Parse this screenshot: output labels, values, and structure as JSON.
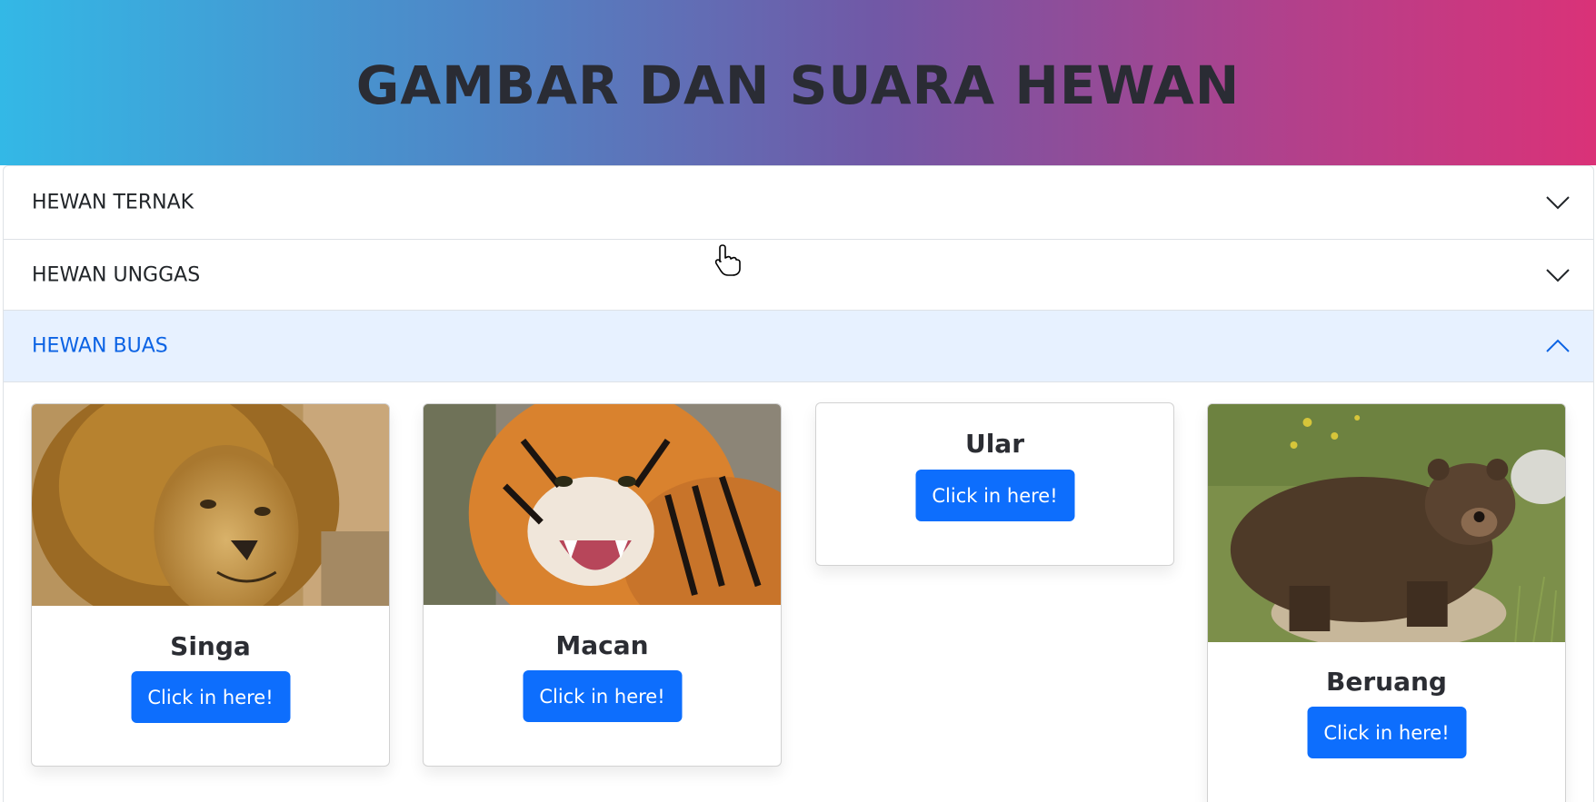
{
  "header": {
    "title": "GAMBAR DAN SUARA HEWAN"
  },
  "accordion": {
    "items": [
      {
        "label": "HEWAN TERNAK",
        "expanded": false,
        "icon": "chevron-down-icon"
      },
      {
        "label": "HEWAN UNGGAS",
        "expanded": false,
        "icon": "chevron-down-icon"
      },
      {
        "label": "HEWAN BUAS",
        "expanded": true,
        "icon": "chevron-up-icon"
      }
    ]
  },
  "cards": [
    {
      "name": "Singa",
      "button": "Click in here!",
      "image": "lion-photo"
    },
    {
      "name": "Macan",
      "button": "Click in here!",
      "image": "tiger-photo"
    },
    {
      "name": "Ular",
      "button": "Click in here!",
      "image": "none"
    },
    {
      "name": "Beruang",
      "button": "Click in here!",
      "image": "bear-photo"
    }
  ],
  "colors": {
    "gradient_start": "#33b8e6",
    "gradient_end": "#da3278",
    "button": "#0d6efd",
    "active_header_bg": "#e7f1ff",
    "active_header_text": "#0c63e4"
  }
}
